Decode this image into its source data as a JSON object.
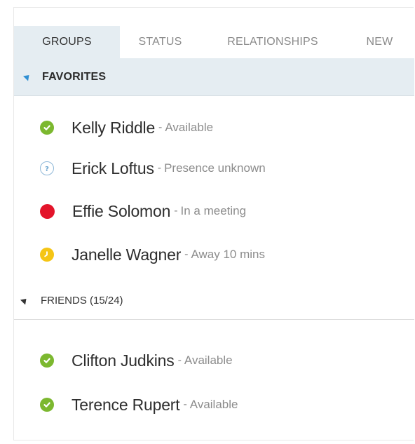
{
  "tabs": [
    {
      "label": "GROUPS",
      "active": true
    },
    {
      "label": "STATUS",
      "active": false
    },
    {
      "label": "RELATIONSHIPS",
      "active": false
    },
    {
      "label": "NEW",
      "active": false
    }
  ],
  "groups": {
    "favorites": {
      "title": "FAVORITES",
      "contacts": [
        {
          "name": "Kelly Riddle",
          "separator": "-",
          "status": "Available",
          "presence": "available",
          "icon": "check-icon",
          "color": "#7cb82f"
        },
        {
          "name": "Erick Loftus",
          "separator": "-",
          "status": "Presence unknown",
          "presence": "unknown",
          "icon": "question-icon",
          "color": "#8fb8d8"
        },
        {
          "name": "Effie Solomon",
          "separator": "-",
          "status": "In a meeting",
          "presence": "busy",
          "icon": "busy-dot-icon",
          "color": "#e3142a"
        },
        {
          "name": "Janelle Wagner",
          "separator": "-",
          "status": "Away 10 mins",
          "presence": "away",
          "icon": "clock-icon",
          "color": "#f5c515"
        }
      ]
    },
    "friends": {
      "title": "FRIENDS (15/24)",
      "contacts": [
        {
          "name": "Clifton Judkins",
          "separator": "-",
          "status": "Available",
          "presence": "available",
          "icon": "check-icon",
          "color": "#7cb82f"
        },
        {
          "name": "Terence Rupert",
          "separator": "-",
          "status": "Available",
          "presence": "available",
          "icon": "check-icon",
          "color": "#7cb82f"
        }
      ]
    }
  }
}
